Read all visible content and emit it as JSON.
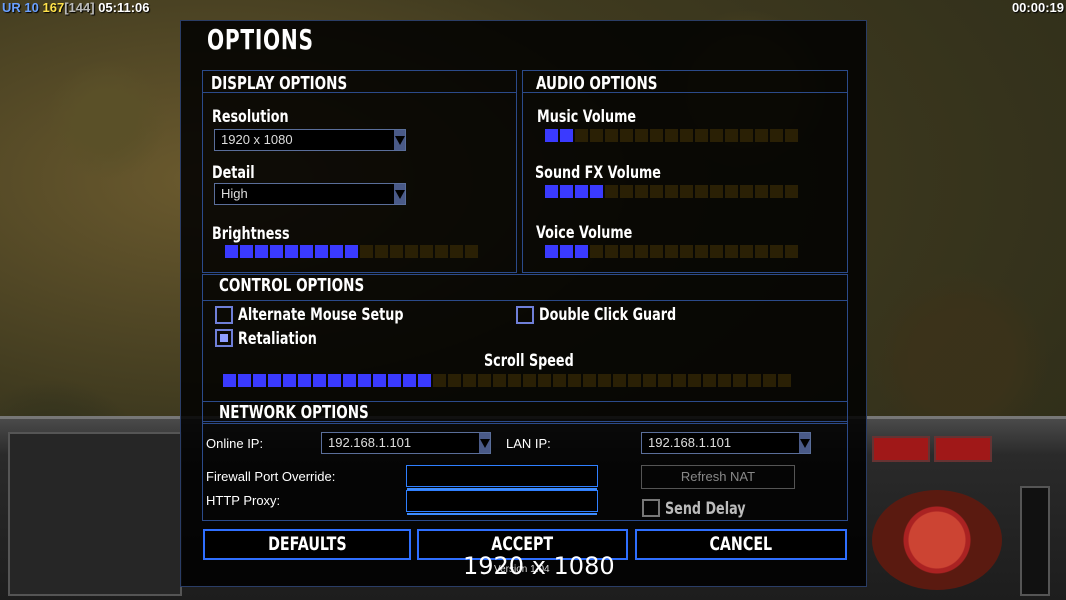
{
  "hud": {
    "faction": "UR",
    "level": "10",
    "money": "167",
    "bracket_value": "[144]",
    "elapsed_left": "05:11:06",
    "elapsed_right": "00:00:19"
  },
  "dialog": {
    "title": "OPTIONS",
    "display": {
      "heading": "DISPLAY OPTIONS",
      "resolution_label": "Resolution",
      "resolution_value": "1920 x 1080",
      "detail_label": "Detail",
      "detail_value": "High",
      "brightness_label": "Brightness",
      "brightness_level": 9,
      "brightness_total": 17
    },
    "audio": {
      "heading": "AUDIO OPTIONS",
      "music_label": "Music Volume",
      "music_level": 2,
      "music_total": 17,
      "sfx_label": "Sound FX Volume",
      "sfx_level": 4,
      "sfx_total": 17,
      "voice_label": "Voice Volume",
      "voice_level": 3,
      "voice_total": 17
    },
    "control": {
      "heading": "CONTROL OPTIONS",
      "alt_mouse_label": "Alternate Mouse Setup",
      "alt_mouse_checked": false,
      "double_click_label": "Double Click Guard",
      "double_click_checked": false,
      "retaliation_label": "Retaliation",
      "retaliation_checked": true,
      "scroll_label": "Scroll Speed",
      "scroll_level": 14,
      "scroll_total": 38
    },
    "network": {
      "heading": "NETWORK OPTIONS",
      "online_ip_label": "Online IP:",
      "online_ip_value": "192.168.1.101",
      "lan_ip_label": "LAN IP:",
      "lan_ip_value": "192.168.1.101",
      "firewall_label": "Firewall Port Override:",
      "firewall_value": "",
      "proxy_label": "HTTP Proxy:",
      "proxy_value": "",
      "refresh_nat_label": "Refresh NAT",
      "send_delay_label": "Send Delay",
      "send_delay_checked": false
    },
    "buttons": {
      "defaults": "DEFAULTS",
      "accept": "ACCEPT",
      "cancel": "CANCEL"
    },
    "version": "Version 1.04",
    "resolution_overlay": "1920 x 1080"
  },
  "colors": {
    "accent": "#2f6fff",
    "slider_on": "#3a3aff",
    "slider_off": "#2a2005"
  }
}
